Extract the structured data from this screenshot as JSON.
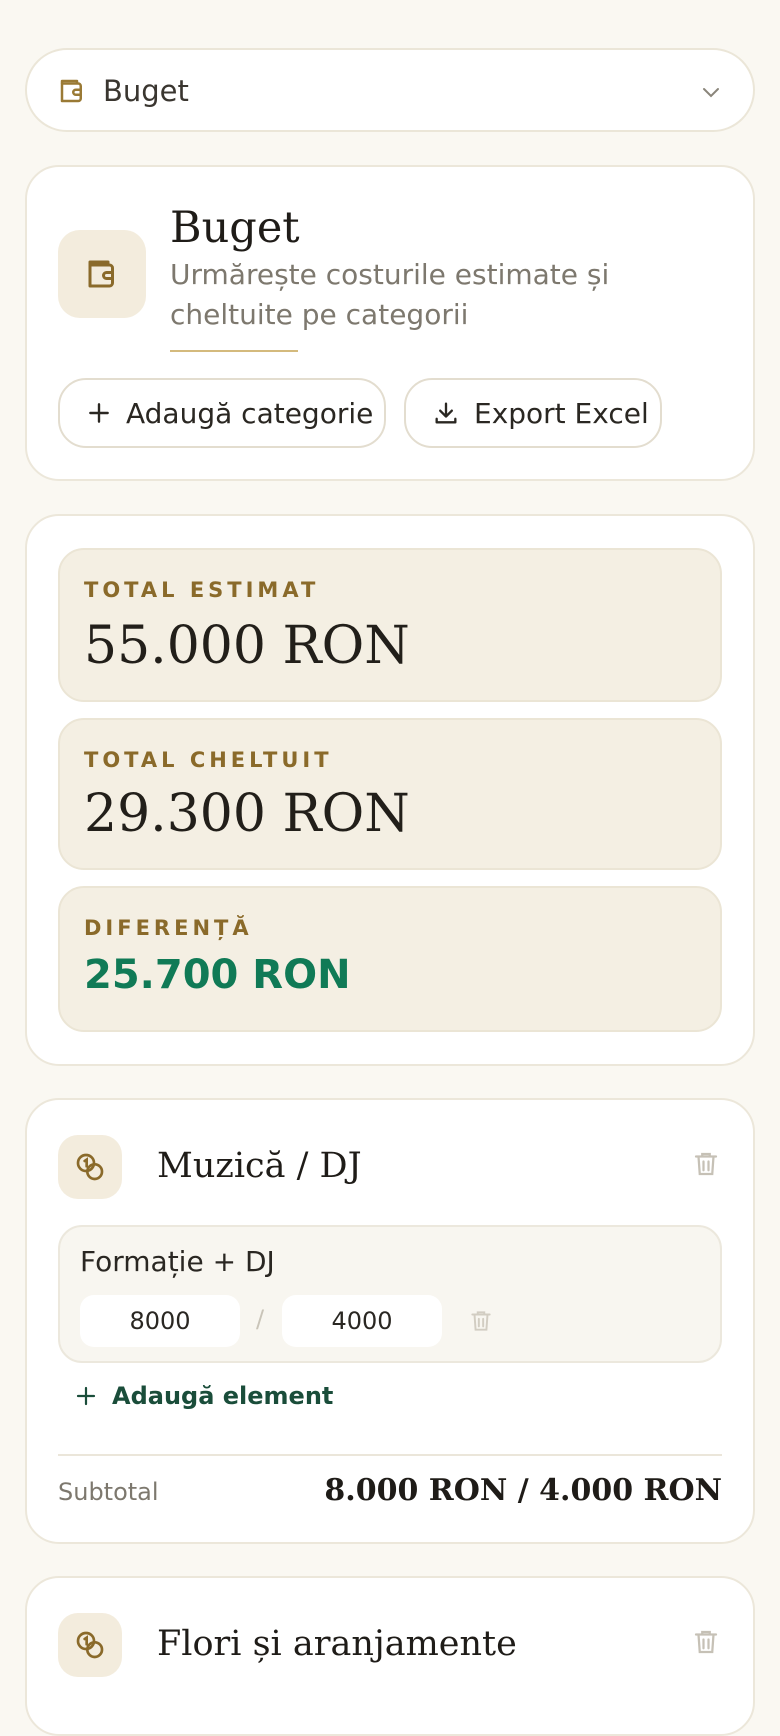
{
  "section_select": {
    "label": "Buget",
    "icon": "wallet-icon"
  },
  "header": {
    "title": "Buget",
    "subtitle": "Urmărește costurile estimate și cheltuite pe categorii",
    "add_category_label": "Adaugă categorie",
    "export_label": "Export Excel"
  },
  "totals": {
    "estimated_label": "TOTAL ESTIMAT",
    "estimated_value": "55.000 RON",
    "spent_label": "TOTAL CHELTUIT",
    "spent_value": "29.300 RON",
    "difference_label": "DIFERENȚĂ",
    "difference_value": "25.700 RON",
    "difference_color": "#107a56"
  },
  "categories": [
    {
      "name": "Muzică / DJ",
      "items": [
        {
          "name": "Formație + DJ",
          "estimated": "8000",
          "spent": "4000"
        }
      ],
      "add_item_label": "Adaugă element",
      "subtotal_label": "Subtotal",
      "subtotal_value": "8.000 RON / 4.000 RON"
    },
    {
      "name": "Flori și aranjamente"
    }
  ],
  "colors": {
    "accent": "#8a6a2a",
    "background": "#faf8f2",
    "positive": "#107a56"
  }
}
